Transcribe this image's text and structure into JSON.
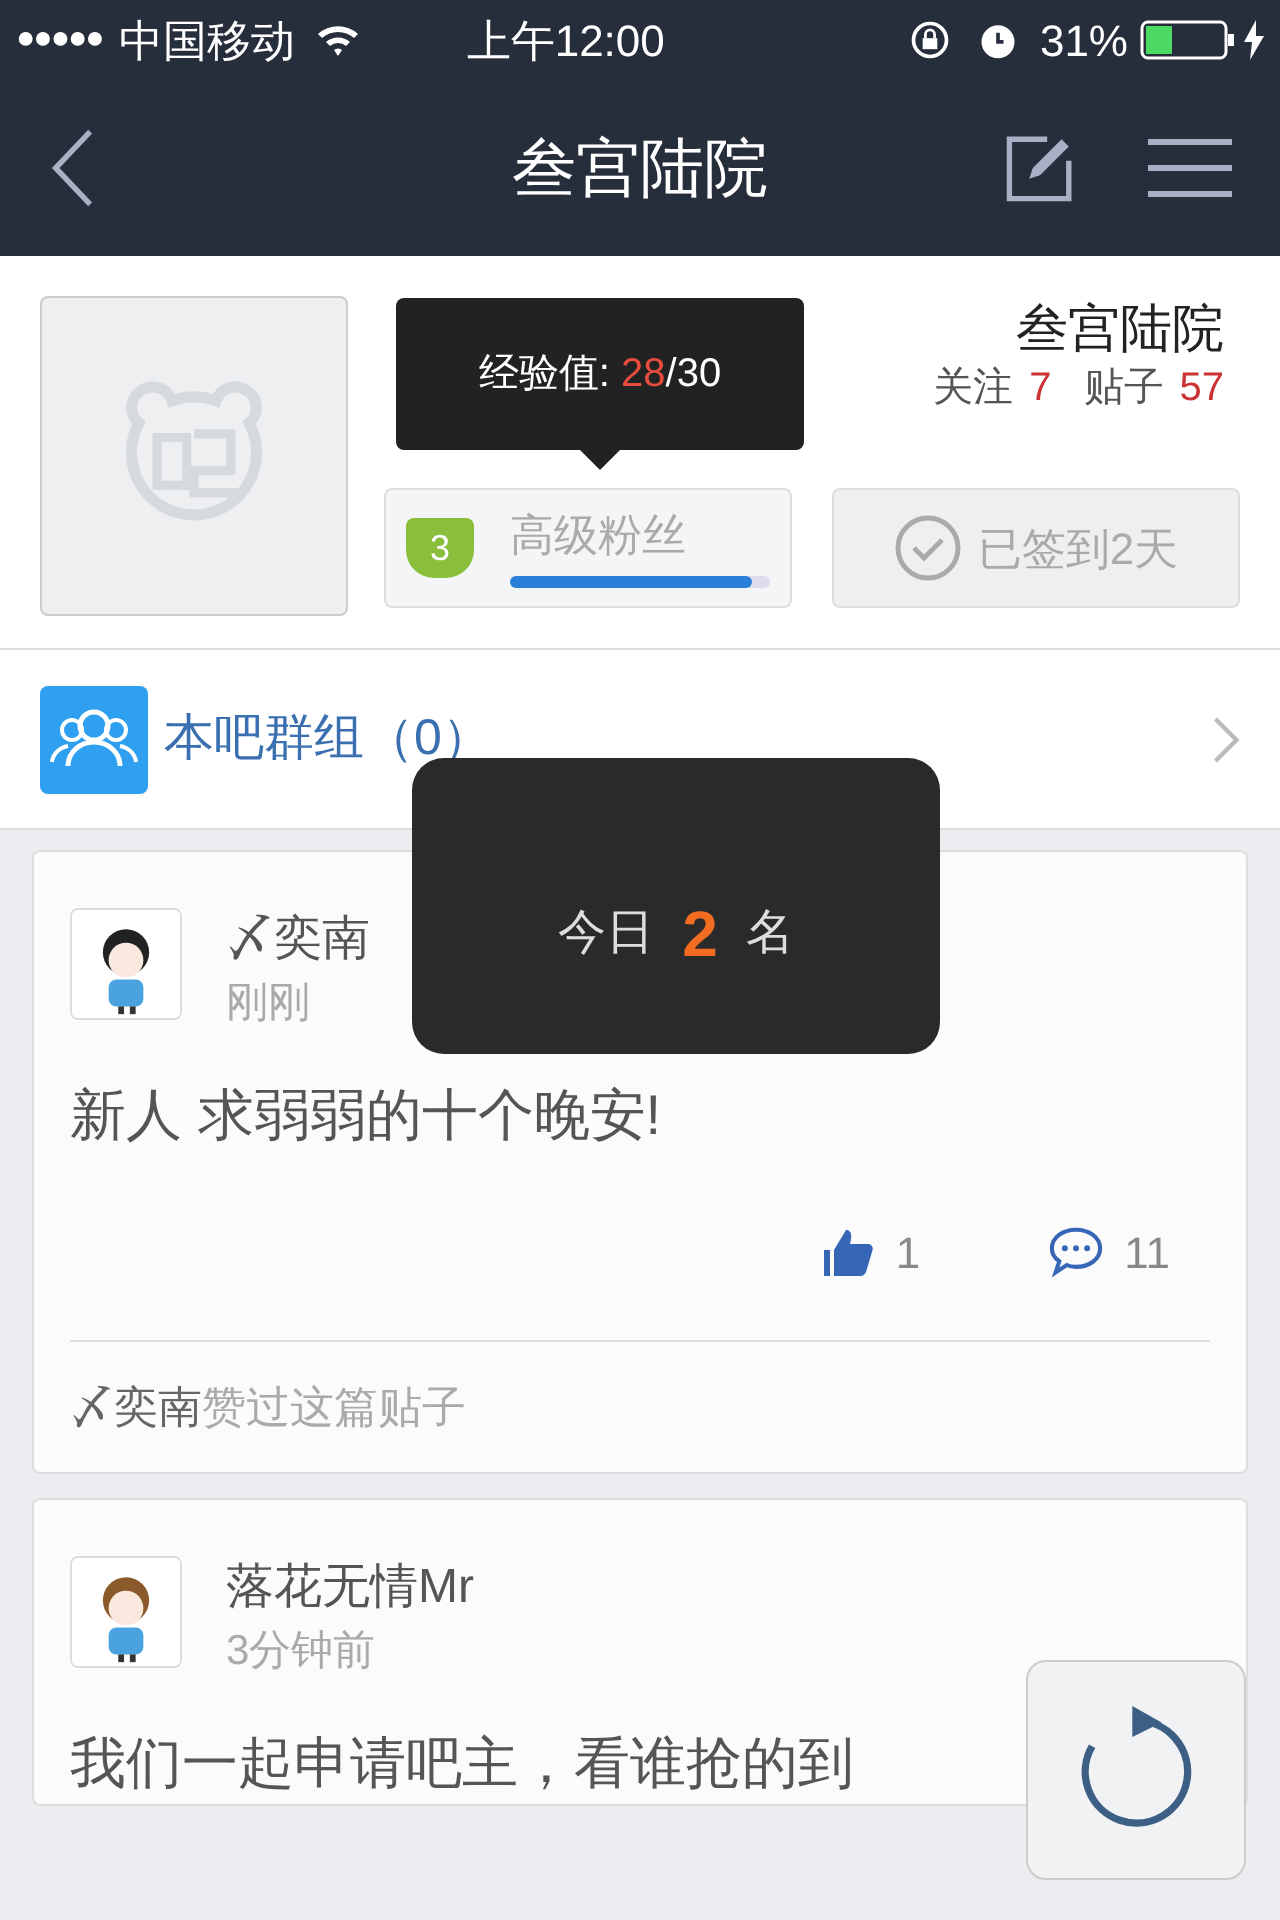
{
  "status_bar": {
    "signal": "●●●●●",
    "carrier": "中国移动",
    "time": "上午12:00",
    "battery": "31%"
  },
  "nav": {
    "title": "叁宫陆院"
  },
  "forum": {
    "name": "叁宫陆院",
    "follow_label": "关注",
    "follow_count": "7",
    "posts_label": "贴子",
    "posts_count": "57",
    "level_badge": "3",
    "level_title": "高级粉丝",
    "level": 0.93,
    "signin": "已签到2天"
  },
  "tooltip": {
    "label": "经验值: ",
    "current": "28",
    "total": "/30"
  },
  "group": {
    "label": "本吧群组（0）"
  },
  "toast": {
    "prefix": "今日",
    "rank": "2",
    "suffix": "名"
  },
  "posts": [
    {
      "author": "〆奕南",
      "time": "刚刚",
      "text": "新人 求弱弱的十个晚安!",
      "likes": "1",
      "comments": "11",
      "liked_by": "〆奕南",
      "liked_suffix": "赞过这篇贴子"
    },
    {
      "author": "落花无情Mr",
      "time": "3分钟前",
      "text": "我们一起申请吧主，看谁抢的到"
    }
  ]
}
